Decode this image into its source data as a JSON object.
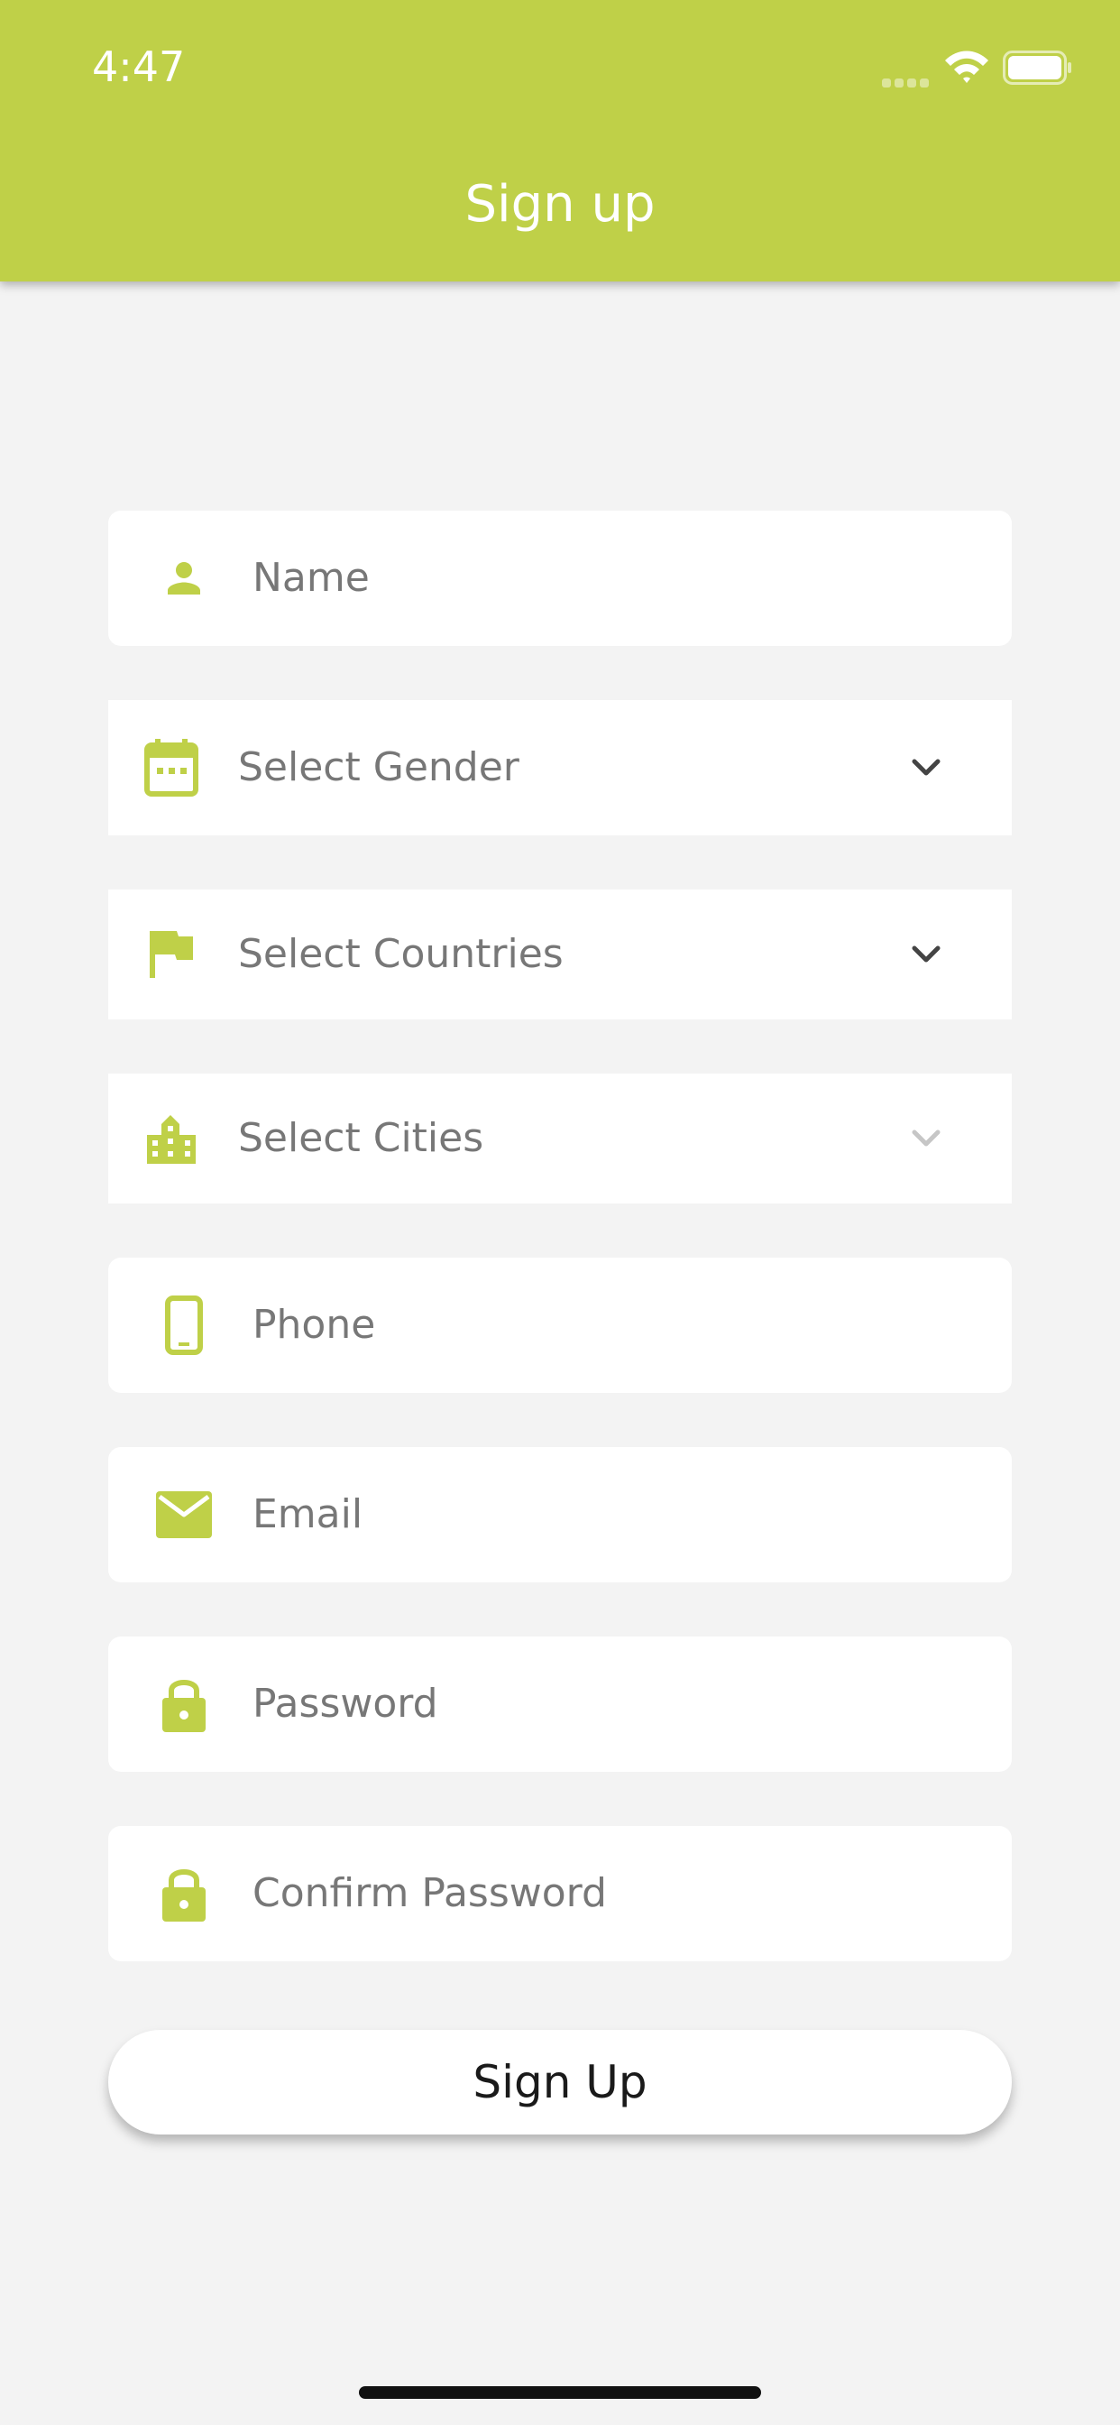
{
  "status_bar": {
    "time": "4:47"
  },
  "header": {
    "title": "Sign up"
  },
  "form": {
    "name": {
      "placeholder": "Name",
      "icon": "person-icon"
    },
    "gender": {
      "placeholder": "Select Gender",
      "icon": "calendar-icon"
    },
    "country": {
      "placeholder": "Select Countries",
      "icon": "flag-icon"
    },
    "city": {
      "placeholder": "Select Cities",
      "icon": "building-icon",
      "disabled": true
    },
    "phone": {
      "placeholder": "Phone",
      "icon": "phone-icon"
    },
    "email": {
      "placeholder": "Email",
      "icon": "mail-icon"
    },
    "password": {
      "placeholder": "Password",
      "icon": "lock-icon"
    },
    "confirm_password": {
      "placeholder": "Confirm Password",
      "icon": "lock-icon"
    },
    "submit_label": "Sign Up"
  },
  "colors": {
    "accent": "#bfd048",
    "background": "#f3f3f3",
    "field_background": "#ffffff",
    "placeholder_text": "#777777"
  }
}
